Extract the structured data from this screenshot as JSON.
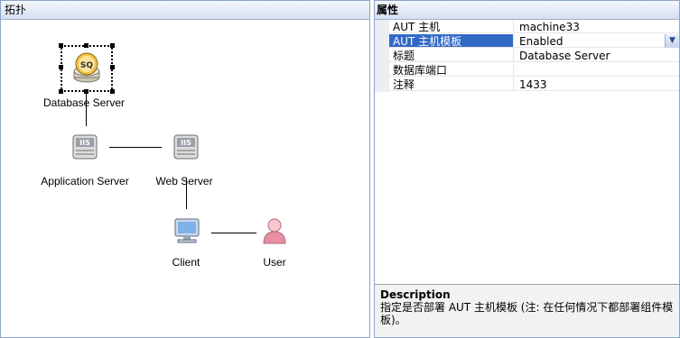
{
  "topology_panel": {
    "title": "拓扑"
  },
  "nodes": {
    "database": {
      "label": "Database Server",
      "icon_text": "SQ"
    },
    "app": {
      "label": "Application Server",
      "icon_text": "IIS"
    },
    "web": {
      "label": "Web Server",
      "icon_text": "IIS"
    },
    "client": {
      "label": "Client"
    },
    "user": {
      "label": "User"
    }
  },
  "properties_panel": {
    "title": "属性",
    "rows": [
      {
        "name": "AUT 主机",
        "value": "machine33"
      },
      {
        "name": "AUT 主机模板",
        "value": "Enabled"
      },
      {
        "name": "标题",
        "value": "Database Server"
      },
      {
        "name": "数据库端口",
        "value": ""
      },
      {
        "name": "注释",
        "value": "1433"
      }
    ],
    "selected_row_index": 1,
    "description": {
      "title": "Description",
      "text": "指定是否部署 AUT 主机模板 (注: 在任何情况下都部署组件模板)。"
    }
  },
  "colors": {
    "accent": "#3169c6",
    "header_bg": "#d6e0f1",
    "border": "#8da2c6"
  },
  "icons": [
    "sql-server-icon",
    "iis-server-icon",
    "client-monitor-icon",
    "user-icon",
    "chevron-down-icon"
  ]
}
